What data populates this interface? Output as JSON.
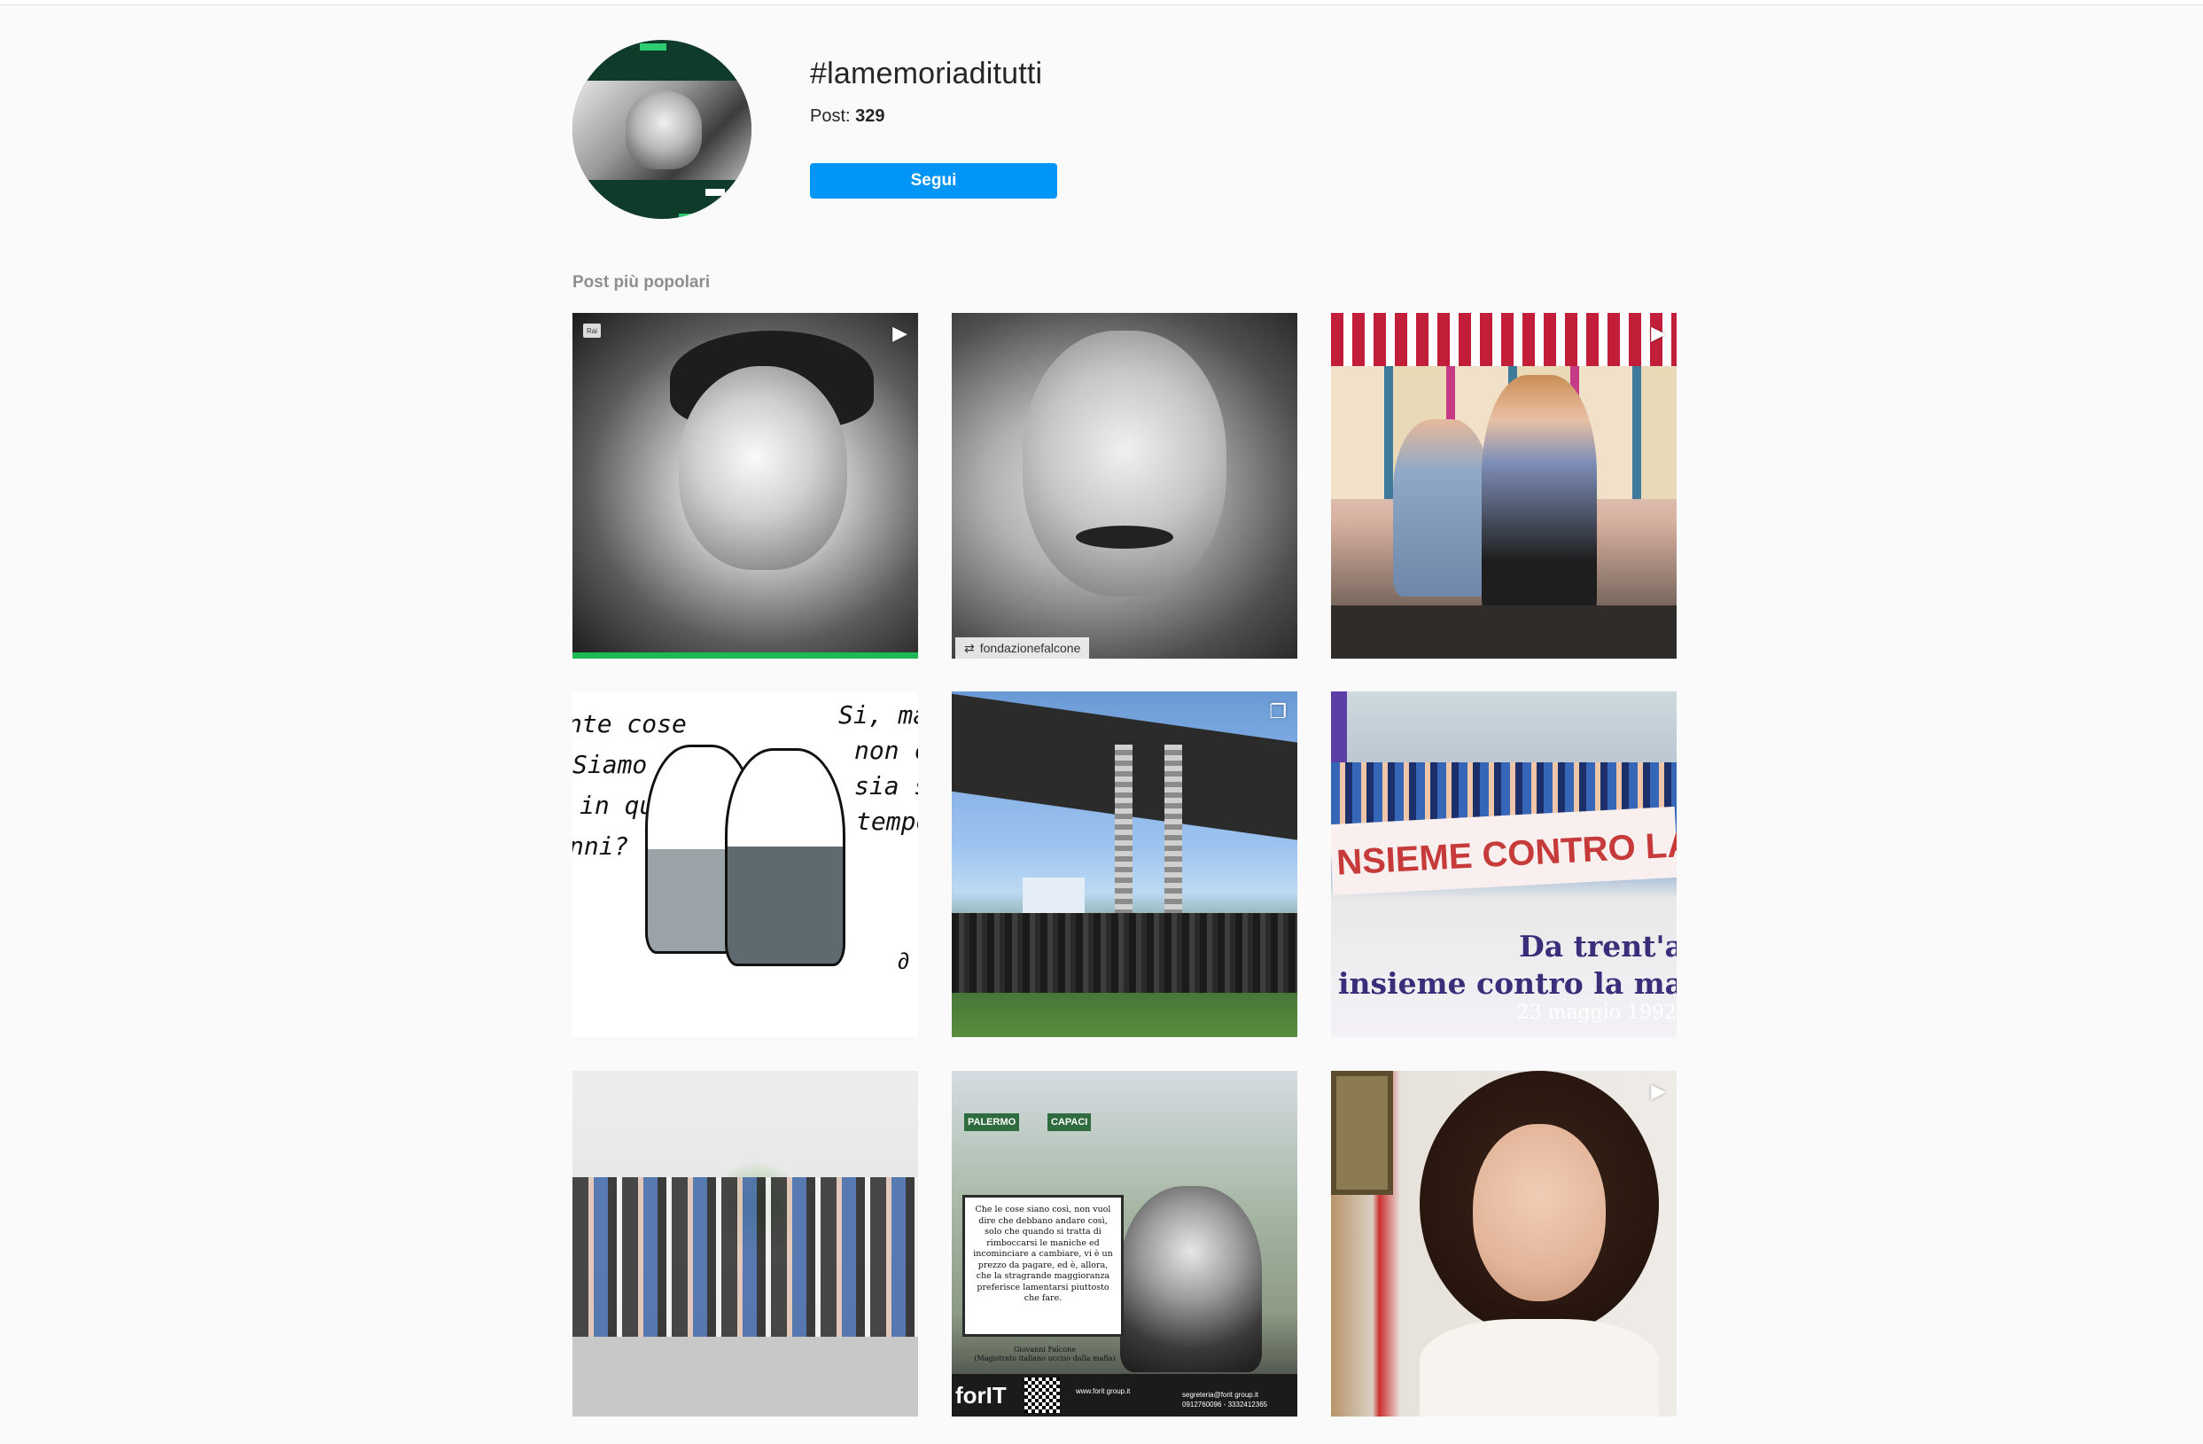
{
  "header": {
    "hashtag": "#lamemoriaditutti",
    "post_label": "Post:",
    "post_count": "329",
    "follow_label": "Segui"
  },
  "section": {
    "title": "Post più popolari"
  },
  "posts": [
    {
      "type": "video",
      "icon": "play-icon",
      "badge": "Rai"
    },
    {
      "type": "repost",
      "repost_user": "fondazionefalcone"
    },
    {
      "type": "video",
      "icon": "play-icon"
    },
    {
      "type": "image",
      "text_left": [
        "nte cose",
        "Siamo",
        "in questi",
        "nni?"
      ],
      "text_right": [
        "Si, ma s",
        "non ci",
        "sia sta",
        "tempo"
      ]
    },
    {
      "type": "carousel",
      "icon": "carousel-icon"
    },
    {
      "type": "image",
      "banner_text": "NSIEME CONTRO LA M",
      "headline_line1": "Da trent'a",
      "headline_line2": "insieme contro la ma",
      "date": "23 maggio 1992"
    },
    {
      "type": "image"
    },
    {
      "type": "image",
      "signs": [
        "PALERMO",
        "CAPACI"
      ],
      "quote": "Che le cose siano così, non vuol dire che debbano andare così, solo che quando si tratta di rimboccarsi le maniche ed incominciare a cambiare, vi è un prezzo da pagare, ed è, allora, che la stragrande maggioranza preferisce lamentarsi piuttosto che fare.",
      "caption_name": "Giovanni Falcone",
      "caption_role": "(Magistrato italiano ucciso dalla mafia)",
      "logo": "forIT",
      "contact_email": "segreteria@forit group.it",
      "contact_phone": "0912760096 - 3332412365",
      "contact_web": "www.forit group.it"
    },
    {
      "type": "video",
      "icon": "play-icon"
    }
  ],
  "colors": {
    "follow_button": "#0095f6",
    "background": "#fafafa",
    "secondary_text": "#8e8e8e"
  }
}
